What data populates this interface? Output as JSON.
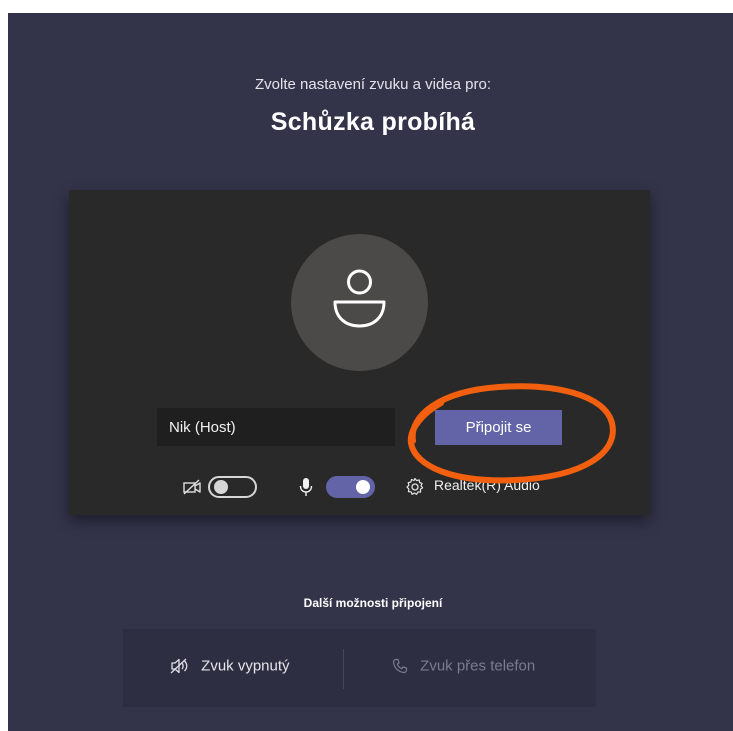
{
  "header": {
    "subtitle": "Zvolte nastavení zvuku a videa pro:",
    "title": "Schůzka probíhá"
  },
  "preview": {
    "name_value": "Nik (Host)",
    "join_label": "Připojit se",
    "camera_toggle_on": false,
    "mic_toggle_on": true,
    "device_label": "Realtek(R) Audio"
  },
  "more_options": {
    "heading": "Další možnosti připojení",
    "audio_off_label": "Zvuk vypnutý",
    "phone_audio_label": "Zvuk přes telefon"
  },
  "colors": {
    "background": "#33344a",
    "preview_bg": "#292929",
    "accent": "#6264a7",
    "annotation": "#f2600f"
  },
  "icons": [
    "avatar-person-icon",
    "camera-off-icon",
    "microphone-icon",
    "gear-icon",
    "speaker-off-icon",
    "phone-icon"
  ]
}
